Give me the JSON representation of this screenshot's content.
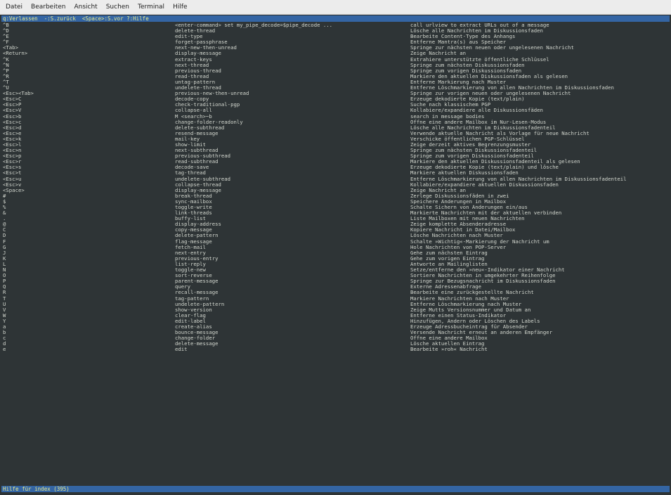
{
  "menubar": [
    "Datei",
    "Bearbeiten",
    "Ansicht",
    "Suchen",
    "Terminal",
    "Hilfe"
  ],
  "status_top": "q:Verlassen  -:S.zurück  <Space>:S.vor ?:Hilfe",
  "status_bottom": "Hilfe für index (395)",
  "rows": [
    [
      "^B",
      "<enter-command> set my_pipe_decode=$pipe_decode ...",
      "call urlview to extract URLs out of a message"
    ],
    [
      "^D",
      "delete-thread",
      "Lösche alle Nachrichten im Diskussionsfaden"
    ],
    [
      "^E",
      "edit-type",
      "Bearbeite Content-Type des Anhangs"
    ],
    [
      "^F",
      "forget-passphrase",
      "Entferne Mantra(s) aus Speicher"
    ],
    [
      "<Tab>",
      "next-new-then-unread",
      "Springe zur nächsten neuen oder ungelesenen Nachricht"
    ],
    [
      "<Return>",
      "display-message",
      "Zeige Nachricht an"
    ],
    [
      "^K",
      "extract-keys",
      "Extrahiere unterstützte öffentliche Schlüssel"
    ],
    [
      "^N",
      "next-thread",
      "Springe zum nächsten Diskussionsfaden"
    ],
    [
      "^P",
      "previous-thread",
      "Springe zum vorigen Diskussionsfaden"
    ],
    [
      "^R",
      "read-thread",
      "Markiere den aktuellen Diskussionsfaden als gelesen"
    ],
    [
      "^T",
      "untag-pattern",
      "Entferne Markierung nach Muster"
    ],
    [
      "^U",
      "undelete-thread",
      "Entferne Löschmarkierung von allen Nachrichten im Diskussionsfaden"
    ],
    [
      "<Esc><Tab>",
      "previous-new-then-unread",
      "Springe zur vorigen neuen oder ungelesenen Nachricht"
    ],
    [
      "<Esc>C",
      "decode-copy",
      "Erzeuge dekodierte Kopie (text/plain)"
    ],
    [
      "<Esc>P",
      "check-traditional-pgp",
      "Suche nach klassischem PGP"
    ],
    [
      "<Esc>V",
      "collapse-all",
      "Kollabiere/expandiere alle Diskussionsfäden"
    ],
    [
      "<Esc>b",
      "M <search>~b",
      "search in message bodies"
    ],
    [
      "<Esc>c",
      "change-folder-readonly",
      "Öffne eine andere Mailbox im Nur-Lesen-Modus"
    ],
    [
      "<Esc>d",
      "delete-subthread",
      "Lösche alle Nachrichten im Diskussionsfadenteil"
    ],
    [
      "<Esc>e",
      "resend-message",
      "Verwende aktuelle Nachricht als Vorlage für neue Nachricht"
    ],
    [
      "<Esc>k",
      "mail-key",
      "Verschicke öffentlichen PGP-Schlüssel"
    ],
    [
      "<Esc>l",
      "show-limit",
      "Zeige derzeit aktives Begrenzungsmuster"
    ],
    [
      "<Esc>n",
      "next-subthread",
      "Springe zum nächsten Diskussionsfadenteil"
    ],
    [
      "<Esc>p",
      "previous-subthread",
      "Springe zum vorigen Diskussionsfadenteil"
    ],
    [
      "<Esc>r",
      "read-subthread",
      "Markiere den aktuellen Diskussionsfadenteil als gelesen"
    ],
    [
      "<Esc>s",
      "decode-save",
      "Erzeuge dekodierte Kopie (text/plain) und lösche"
    ],
    [
      "<Esc>t",
      "tag-thread",
      "Markiere aktuellen Diskussionsfaden"
    ],
    [
      "<Esc>u",
      "undelete-subthread",
      "Entferne Löschmarkierung von allen Nachrichten im Diskussionsfadenteil"
    ],
    [
      "<Esc>v",
      "collapse-thread",
      "Kollabiere/expandiere aktuellen Diskussionsfaden"
    ],
    [
      "<Space>",
      "display-message",
      "Zeige Nachricht an"
    ],
    [
      "#",
      "break-thread",
      "Zerlege Diskussionsfäden in zwei"
    ],
    [
      "$",
      "sync-mailbox",
      "Speichere Änderungen in Mailbox"
    ],
    [
      "%",
      "toggle-write",
      "Schalte Sichern von Änderungen ein/aus"
    ],
    [
      "&",
      "link-threads",
      "Markierte Nachrichten mit der aktuellen verbinden"
    ],
    [
      ".",
      "buffy-list",
      "Liste Mailboxen mit neuen Nachrichten"
    ],
    [
      "@",
      "display-address",
      "Zeige komplette Absenderadresse"
    ],
    [
      "C",
      "copy-message",
      "Kopiere Nachricht in Datei/Mailbox"
    ],
    [
      "D",
      "delete-pattern",
      "Lösche Nachrichten nach Muster"
    ],
    [
      "F",
      "flag-message",
      "Schalte »Wichtig«-Markierung der Nachricht um"
    ],
    [
      "G",
      "fetch-mail",
      "Hole Nachrichten von POP-Server"
    ],
    [
      "J",
      "next-entry",
      "Gehe zum nächsten Eintrag"
    ],
    [
      "K",
      "previous-entry",
      "Gehe zum vorigen Eintrag"
    ],
    [
      "L",
      "list-reply",
      "Antworte an Mailinglisten"
    ],
    [
      "N",
      "toggle-new",
      "Setze/entferne den »neu«-Indikator einer Nachricht"
    ],
    [
      "O",
      "sort-reverse",
      "Sortiere Nachrichten in umgekehrter Reihenfolge"
    ],
    [
      "P",
      "parent-message",
      "Springe zur Bezugsnachricht im Diskussionsfaden"
    ],
    [
      "Q",
      "query",
      "Externe Adressenabfrage"
    ],
    [
      "R",
      "recall-message",
      "Bearbeite eine zurückgestellte Nachricht"
    ],
    [
      "T",
      "tag-pattern",
      "Markiere Nachrichten nach Muster"
    ],
    [
      "U",
      "undelete-pattern",
      "Entferne Löschmarkierung nach Muster"
    ],
    [
      "V",
      "show-version",
      "Zeige Mutts Versionsnummer und Datum an"
    ],
    [
      "W",
      "clear-flag",
      "Entferne einen Status-Indikator"
    ],
    [
      "Y",
      "edit-label",
      "Hinzufügen, Ändern oder Löschen des Labels"
    ],
    [
      "a",
      "create-alias",
      "Erzeuge Adressbucheintrag für Absender"
    ],
    [
      "b",
      "bounce-message",
      "Versende Nachricht erneut an anderen Empfänger"
    ],
    [
      "c",
      "change-folder",
      "Öffne eine andere Mailbox"
    ],
    [
      "d",
      "delete-message",
      "Lösche aktuellen Eintrag"
    ],
    [
      "e",
      "edit",
      "Bearbeite »roh« Nachricht"
    ]
  ]
}
